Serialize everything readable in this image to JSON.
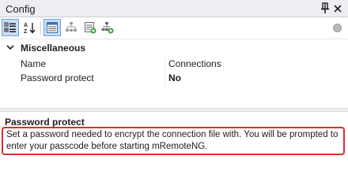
{
  "window": {
    "title": "Config",
    "pin_icon": "pin-icon",
    "close_icon": "close-icon"
  },
  "toolbar": {
    "buttons": [
      {
        "name": "categorized-view-button",
        "icon": "categorized-icon",
        "active": true
      },
      {
        "name": "alphabetical-view-button",
        "icon": "sort-az-icon",
        "active": false
      },
      {
        "name": "properties-view-button",
        "icon": "properties-icon",
        "active": true
      },
      {
        "name": "inheritance-view-button",
        "icon": "inheritance-icon",
        "active": false
      },
      {
        "name": "default-properties-button",
        "icon": "default-properties-icon",
        "active": false
      },
      {
        "name": "default-inheritance-button",
        "icon": "default-inheritance-icon",
        "active": false
      }
    ],
    "status_icon": "status-indicator-icon"
  },
  "grid": {
    "category": {
      "label": "Miscellaneous",
      "expanded": true
    },
    "properties": [
      {
        "name": "Name",
        "value": "Connections",
        "bold": false
      },
      {
        "name": "Password protect",
        "value": "No",
        "bold": true
      }
    ]
  },
  "description": {
    "title": "Password protect",
    "text": "Set a password needed to encrypt the connection file with. You will be prompted to enter your passcode before starting mRemoteNG."
  },
  "colors": {
    "highlight_border": "#d8302f",
    "active_button_bg": "#c9def5",
    "title_bar_bg": "#eeeef2"
  }
}
